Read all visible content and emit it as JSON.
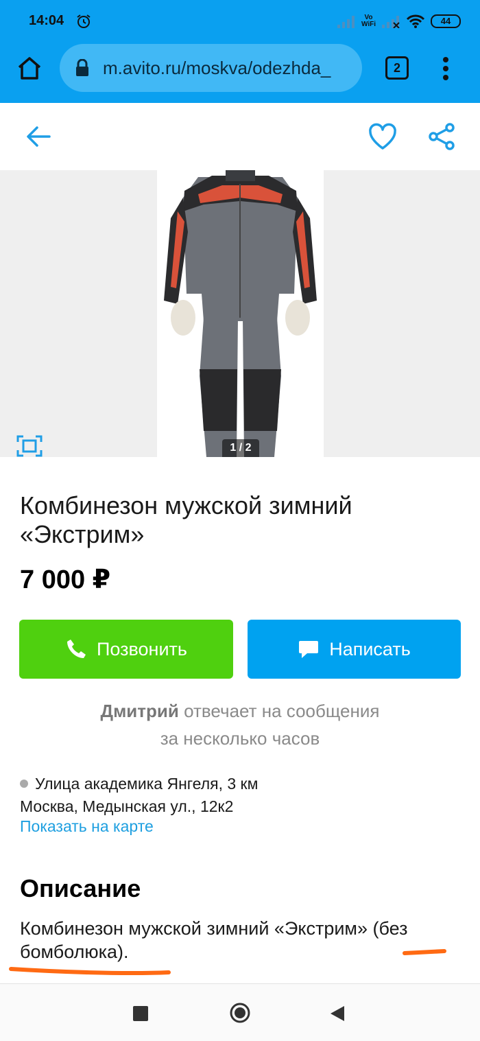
{
  "status_bar": {
    "time": "14:04",
    "vowifi_top": "Vo",
    "vowifi_bottom": "WiFi",
    "battery": "44"
  },
  "browser": {
    "url": "m.avito.ru/moskva/odezhda_",
    "tab_count": "2"
  },
  "gallery": {
    "counter": "1 / 2"
  },
  "listing": {
    "title": "Комбинезон мужской зимний «Экстрим»",
    "price": "7 000 ₽"
  },
  "actions": {
    "call_label": "Позвонить",
    "write_label": "Написать"
  },
  "seller": {
    "name": "Дмитрий",
    "response_line1": "отвечает на сообщения",
    "response_line2": "за несколько часов"
  },
  "location": {
    "metro": "Улица академика Янгеля, 3 км",
    "address": "Москва, Медынская ул., 12к2",
    "map_link": "Показать на карте"
  },
  "description": {
    "heading": "Описание",
    "text": "Комбинезон мужской зимний «Экстрим» (без бомболюка)."
  },
  "colors": {
    "brand_blue": "#0aa0f0",
    "call_green": "#4fd00f",
    "write_blue": "#00a2f0",
    "link_blue": "#1e9fe0",
    "annotation_orange": "#ff6a13"
  }
}
